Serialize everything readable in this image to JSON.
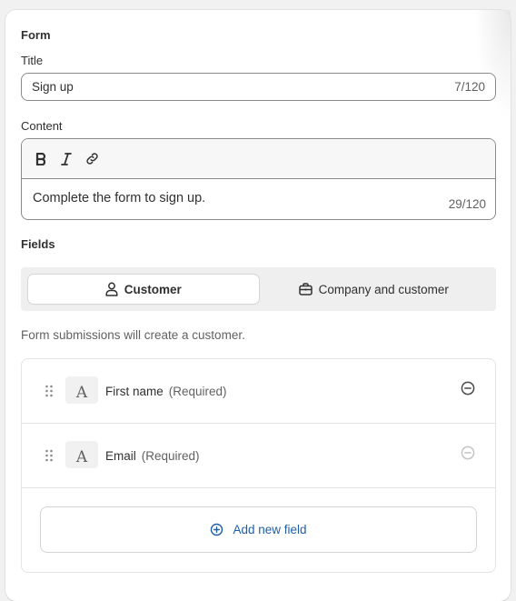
{
  "form": {
    "section_title": "Form",
    "title_label": "Title",
    "title_value": "Sign up",
    "title_count": "7/120",
    "content_label": "Content",
    "content_value": "Complete the form to sign up.",
    "content_count": "29/120",
    "toolbar": {
      "bold_icon": "bold-icon",
      "italic_icon": "italic-icon",
      "link_icon": "link-icon"
    }
  },
  "fields": {
    "section_title": "Fields",
    "segments": [
      {
        "label": "Customer",
        "icon": "person-icon",
        "selected": true
      },
      {
        "label": "Company and customer",
        "icon": "briefcase-icon",
        "selected": false
      }
    ],
    "helper_text": "Form submissions will create a customer.",
    "items": [
      {
        "name": "First name",
        "required_label": "(Required)",
        "type_glyph": "A"
      },
      {
        "name": "Email",
        "required_label": "(Required)",
        "type_glyph": "A"
      }
    ],
    "add_label": "Add new field"
  },
  "colors": {
    "accent_blue": "#1f5fa8",
    "border": "#8a8a8a",
    "muted_text": "#616161"
  }
}
